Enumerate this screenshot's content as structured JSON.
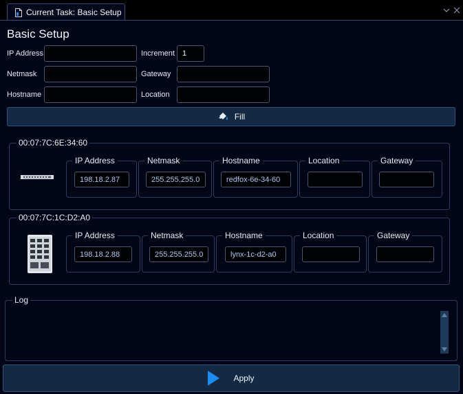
{
  "tab": {
    "title": "Current Task: Basic Setup",
    "icon": "document-icon"
  },
  "window_controls": {
    "dropdown_icon": "chevron-down-icon",
    "close_icon": "close-icon"
  },
  "form": {
    "title": "Basic Setup",
    "ip_label": "IP Address",
    "ip_value": "",
    "netmask_label": "Netmask",
    "netmask_value": "",
    "hostname_label": "Hostname",
    "hostname_value": "",
    "increment_label": "Increment",
    "increment_value": "1",
    "gateway_label": "Gateway",
    "gateway_value": "",
    "location_label": "Location",
    "location_value": "",
    "fill_label": "Fill",
    "fill_icon": "fill-bucket-icon"
  },
  "devices": [
    {
      "mac": "00:07:7C:6E:34:60",
      "image": "rack-switch-image",
      "ip_label": "IP Address",
      "ip": "198.18.2.87",
      "netmask_label": "Netmask",
      "netmask": "255.255.255.0",
      "hostname_label": "Hostname",
      "hostname": "redfox-6e-34-60",
      "location_label": "Location",
      "location": "",
      "gateway_label": "Gateway",
      "gateway": ""
    },
    {
      "mac": "00:07:7C:1C:D2:A0",
      "image": "din-rail-switch-image",
      "ip_label": "IP Address",
      "ip": "198.18.2.88",
      "netmask_label": "Netmask",
      "netmask": "255.255.255.0",
      "hostname_label": "Hostname",
      "hostname": "lynx-1c-d2-a0",
      "location_label": "Location",
      "location": "",
      "gateway_label": "Gateway",
      "gateway": ""
    }
  ],
  "log": {
    "label": "Log",
    "text": ""
  },
  "apply": {
    "label": "Apply",
    "icon": "play-icon"
  },
  "colors": {
    "accent": "#1d8bf0",
    "button_bg": "#142944",
    "panel_bg": "#010616",
    "border": "#2b3d5e",
    "value_text": "#aec6ea"
  }
}
